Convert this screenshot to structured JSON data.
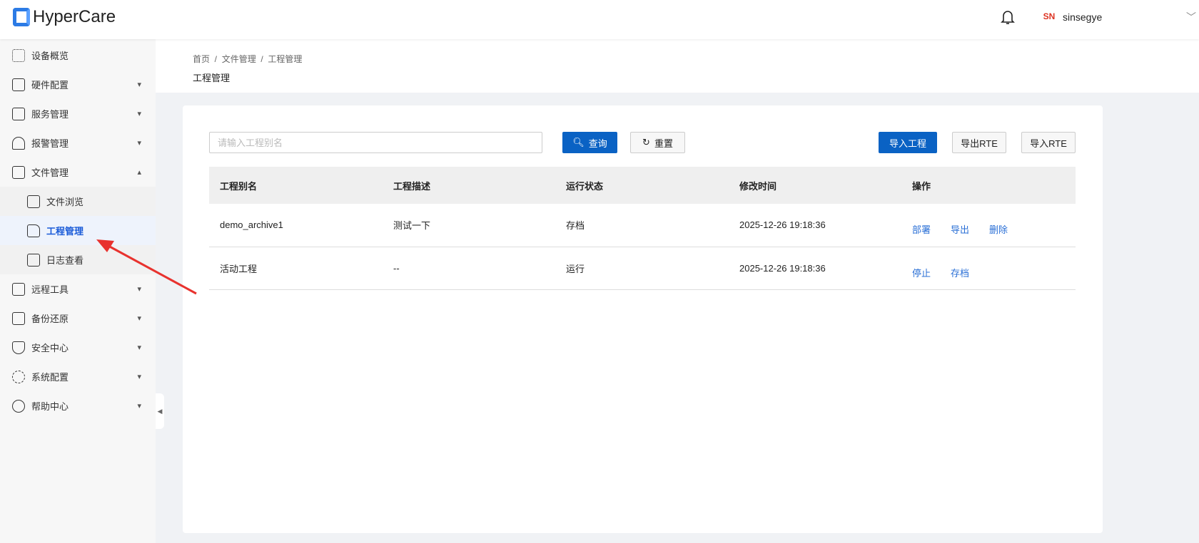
{
  "header": {
    "logo": "HyperCare",
    "username": "sinsegye",
    "avatar_text": "SN"
  },
  "sidebar": {
    "items": [
      {
        "label": "设备概览",
        "icon": "grid-icon",
        "expandable": false
      },
      {
        "label": "硬件配置",
        "icon": "hardware-icon",
        "expandable": true
      },
      {
        "label": "服务管理",
        "icon": "service-icon",
        "expandable": true
      },
      {
        "label": "报警管理",
        "icon": "alarm-icon",
        "expandable": true
      },
      {
        "label": "文件管理",
        "icon": "file-manage-icon",
        "expandable": true,
        "expanded": true
      }
    ],
    "sub_items": [
      {
        "label": "文件浏览"
      },
      {
        "label": "工程管理",
        "active": true
      },
      {
        "label": "日志查看"
      }
    ],
    "items_after": [
      {
        "label": "远程工具"
      },
      {
        "label": "备份还原"
      },
      {
        "label": "安全中心"
      },
      {
        "label": "系统配置"
      },
      {
        "label": "帮助中心"
      }
    ]
  },
  "breadcrumb": [
    "首页",
    "文件管理",
    "工程管理"
  ],
  "page_title": "工程管理",
  "toolbar": {
    "search_placeholder": "请输入工程别名",
    "query": "查询",
    "reset": "重置",
    "import_project": "导入工程",
    "export_rte": "导出RTE",
    "import_rte": "导入RTE"
  },
  "table": {
    "headers": [
      "工程别名",
      "工程描述",
      "运行状态",
      "修改时间",
      "操作"
    ],
    "rows": [
      {
        "name": "demo_archive1",
        "desc": "测试一下",
        "status": "存档",
        "time": "2025-12-26 19:18:36",
        "actions": [
          "部署",
          "导出",
          "删除"
        ]
      },
      {
        "name": "活动工程",
        "desc": "--",
        "status": "运行",
        "time": "2025-12-26 19:18:36",
        "actions": [
          "停止",
          "存档"
        ]
      }
    ]
  },
  "colors": {
    "primary": "#0a62c4",
    "link": "#2a6fd6",
    "active_bg": "#eef3fc",
    "annotation": "#e8322e"
  }
}
